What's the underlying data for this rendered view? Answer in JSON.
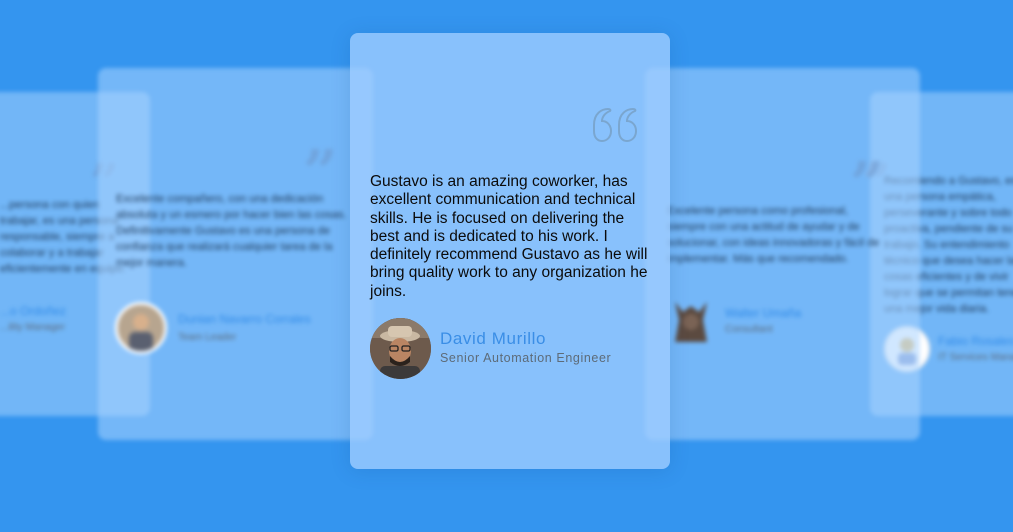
{
  "cards": {
    "far_left": {
      "text": "...persona con quien trabajar, es una persona responsable, siempre a colaborar y a trabajar eficientemente en equipo.",
      "name": "...o Ordoñez",
      "role": "...ility Manager"
    },
    "left": {
      "text": "Excelente compañero, con una dedicación absoluta y un esmero por hacer bien las cosas. Definitivamente Gustavo es una persona de confianza que realizará cualquier tarea de la mejor manera.",
      "name": "Dunian Navarro Corrales",
      "role": "Team Leader"
    },
    "center": {
      "text": "Gustavo is an amazing coworker, has excellent communication and technical skills. He is focused on delivering the best and is dedicated to his work. I definitely recommend Gustavo as he will bring quality work to any organization he joins.",
      "name": "David Murillo",
      "role": "Senior Automation Engineer"
    },
    "right": {
      "text": "Excelente persona como profesional, siempre con una actitud de ayudar y de solucionar, con ideas innovadoras y fácil de implementar. Más que recomendado.",
      "name": "Walter Umaña",
      "role": "Consultant"
    },
    "far_right": {
      "text": "Recomiendo a Gustavo, es una persona empática, perseverante y sobre todo proactiva, pendiente de su trabajo. Su entendimiento técnico que desea hacer las cosas eficientes y de vivir lograr que se permitan tener una mejor vida diaria.",
      "name": "Fabio Rosales",
      "role": "IT Services Manager"
    }
  },
  "colors": {
    "background": "#3495ef",
    "name_accent": "#3a8ee6"
  },
  "icons": {
    "quote": "quote-mark-icon"
  }
}
